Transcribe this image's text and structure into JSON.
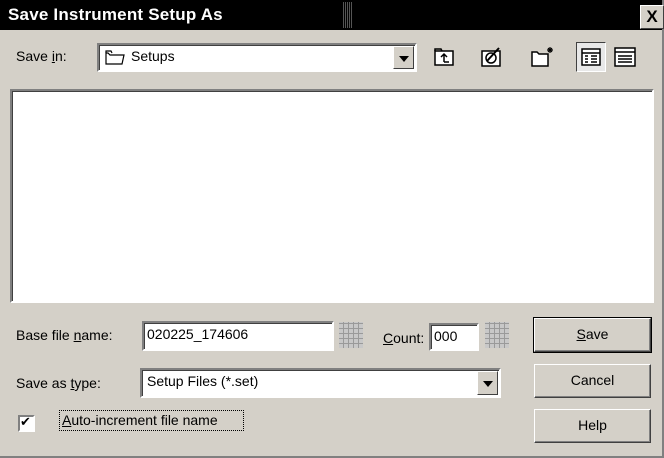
{
  "window": {
    "title": "Save Instrument Setup As",
    "close_glyph": "X"
  },
  "save_in": {
    "label_pre": "Save ",
    "label_key": "i",
    "label_post": "n:",
    "value": "Setups",
    "folder_icon": "folder-icon"
  },
  "toolbar": {
    "icons": [
      "up-one-level-icon",
      "web-folder-icon",
      "new-folder-icon",
      "list-view-icon",
      "details-view-icon"
    ]
  },
  "base_file_name": {
    "label_pre": "Base file ",
    "label_key": "n",
    "label_post": "ame:",
    "value": "020225_174606"
  },
  "count": {
    "label_key": "C",
    "label_post": "ount:",
    "value": "000"
  },
  "save_as_type": {
    "label_pre": "Save as ",
    "label_key": "t",
    "label_post": "ype:",
    "value": "Setup Files (*.set)"
  },
  "auto_increment": {
    "checked": true,
    "label_key": "A",
    "label_post": "uto-increment file name"
  },
  "buttons": {
    "save_key": "S",
    "save_post": "ave",
    "cancel": "Cancel",
    "help": "Help"
  }
}
